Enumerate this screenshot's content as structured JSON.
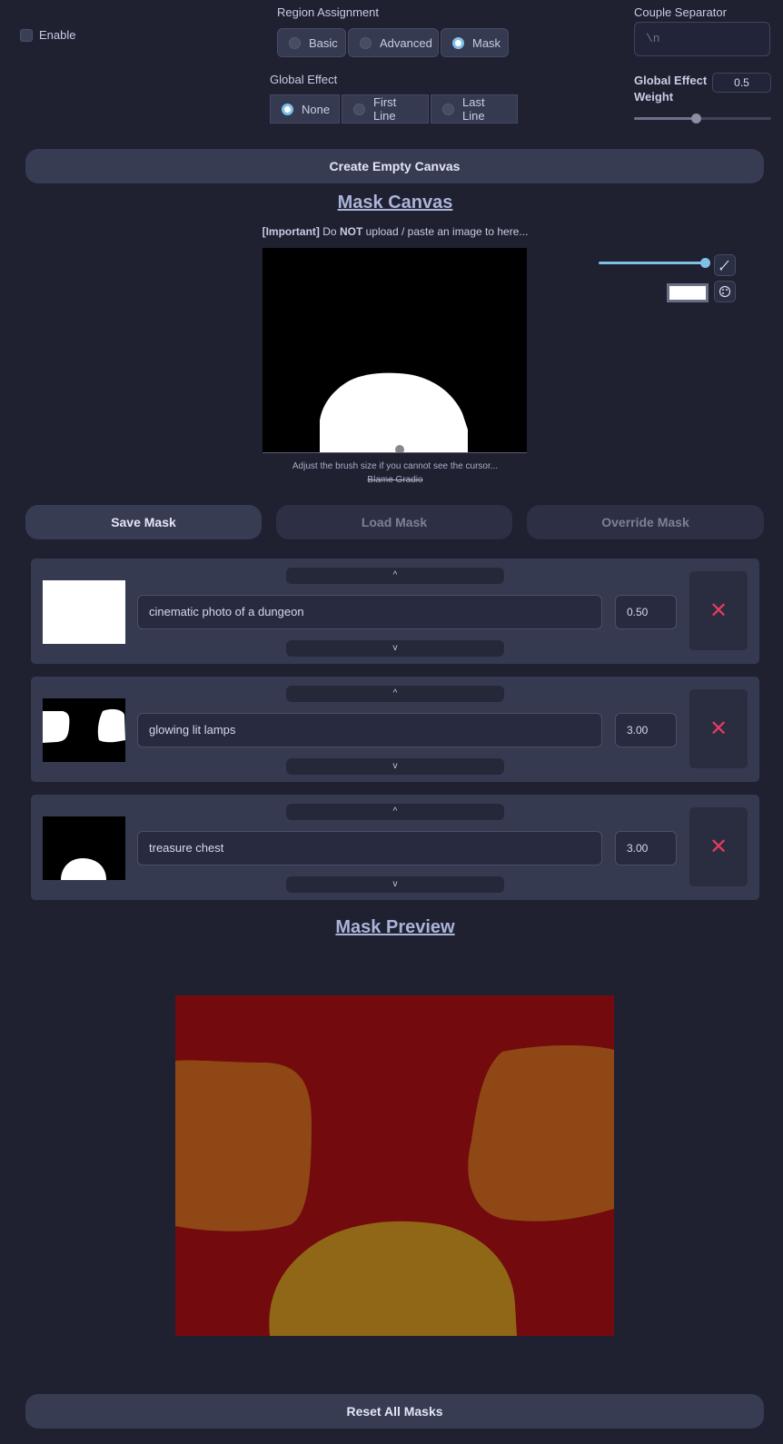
{
  "enable": {
    "label": "Enable",
    "checked": false
  },
  "region_assignment": {
    "label": "Region Assignment",
    "options": [
      "Basic",
      "Advanced",
      "Mask"
    ],
    "selected": "Mask"
  },
  "global_effect": {
    "label": "Global Effect",
    "options": [
      "None",
      "First Line",
      "Last Line"
    ],
    "selected": "None"
  },
  "couple_separator": {
    "label": "Couple Separator",
    "placeholder": "\\n"
  },
  "global_effect_weight": {
    "label_line1": "Global Effect",
    "label_line2": "Weight",
    "value": "0.5",
    "slider_fraction": 0.45
  },
  "create_canvas_button": "Create Empty Canvas",
  "mask_canvas": {
    "title": "Mask Canvas",
    "important_prefix": "[Important]",
    "important_mid1": " Do ",
    "important_bold": "NOT",
    "important_rest": " upload / paste an image to here...",
    "brush_hint": "Adjust the brush size if you cannot see the cursor...",
    "blame": "Blame Gradio",
    "brush_size_fraction": 1.0,
    "brush_color": "#ffffff"
  },
  "mask_buttons": {
    "save": "Save Mask",
    "load": "Load Mask",
    "override": "Override Mask"
  },
  "layers": [
    {
      "prompt": "cinematic photo of a dungeon",
      "weight": "0.50",
      "up": "^",
      "down": "v",
      "delete": "✕"
    },
    {
      "prompt": "glowing lit lamps",
      "weight": "3.00",
      "up": "^",
      "down": "v",
      "delete": "✕"
    },
    {
      "prompt": "treasure chest",
      "weight": "3.00",
      "up": "^",
      "down": "v",
      "delete": "✕"
    }
  ],
  "mask_preview": {
    "title": "Mask Preview",
    "colors": {
      "background": "#730a0e",
      "lamps": "#8f4815",
      "chest": "#8f6716"
    }
  },
  "reset_button": "Reset All Masks"
}
